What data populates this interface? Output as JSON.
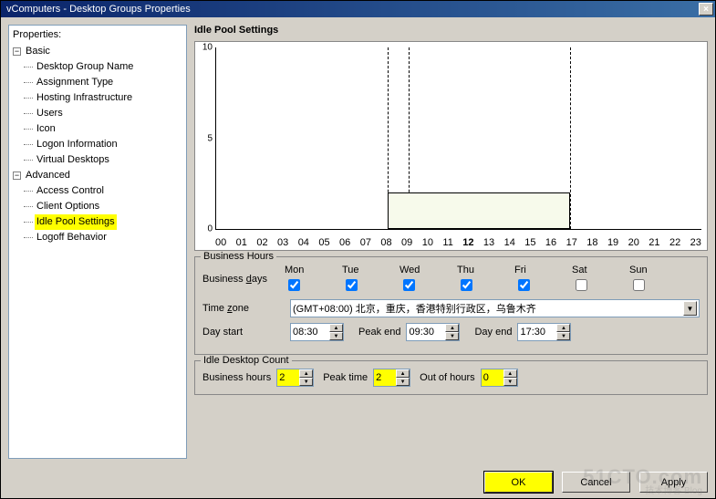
{
  "titlebar": {
    "text": "vComputers - Desktop Groups Properties",
    "close": "×"
  },
  "tree": {
    "label": "Properties:",
    "basic": {
      "label": "Basic",
      "children": [
        "Desktop Group Name",
        "Assignment Type",
        "Hosting Infrastructure",
        "Users",
        "Icon",
        "Logon Information",
        "Virtual Desktops"
      ]
    },
    "advanced": {
      "label": "Advanced",
      "children": [
        "Access Control",
        "Client Options",
        "Idle Pool Settings",
        "Logoff Behavior"
      ],
      "selected_index": 2
    }
  },
  "section_title": "Idle Pool Settings",
  "chart_data": {
    "type": "bar",
    "x_ticks": [
      "00",
      "01",
      "02",
      "03",
      "04",
      "05",
      "06",
      "07",
      "08",
      "09",
      "10",
      "11",
      "12",
      "13",
      "14",
      "15",
      "16",
      "17",
      "18",
      "19",
      "20",
      "21",
      "22",
      "23"
    ],
    "bold_x_index": 12,
    "y_ticks": [
      0,
      5,
      10
    ],
    "ylim": [
      0,
      10
    ],
    "bar": {
      "start_hour": 8.5,
      "end_hour": 17.5,
      "value": 2
    },
    "marker_hours": [
      8.5,
      9.5,
      17.5
    ]
  },
  "business_hours": {
    "legend": "Business Hours",
    "days_label": "Business days",
    "days": [
      {
        "label": "Mon",
        "checked": true
      },
      {
        "label": "Tue",
        "checked": true
      },
      {
        "label": "Wed",
        "checked": true
      },
      {
        "label": "Thu",
        "checked": true
      },
      {
        "label": "Fri",
        "checked": true
      },
      {
        "label": "Sat",
        "checked": false
      },
      {
        "label": "Sun",
        "checked": false
      }
    ],
    "tz_label": "Time zone",
    "tz_value": "(GMT+08:00) 北京，重庆，香港特别行政区，乌鲁木齐",
    "day_start_label": "Day start",
    "day_start": "08:30",
    "peak_end_label": "Peak end",
    "peak_end": "09:30",
    "day_end_label": "Day end",
    "day_end": "17:30"
  },
  "idle_count": {
    "legend": "Idle Desktop Count",
    "business_hours_label": "Business hours",
    "business_hours": "2",
    "peak_time_label": "Peak time",
    "peak_time": "2",
    "out_of_hours_label": "Out of hours",
    "out_of_hours": "0"
  },
  "buttons": {
    "ok": "OK",
    "cancel": "Cancel",
    "apply": "Apply"
  },
  "watermark": {
    "main": "51CTO.com",
    "sub": "技术博客 Blog"
  }
}
